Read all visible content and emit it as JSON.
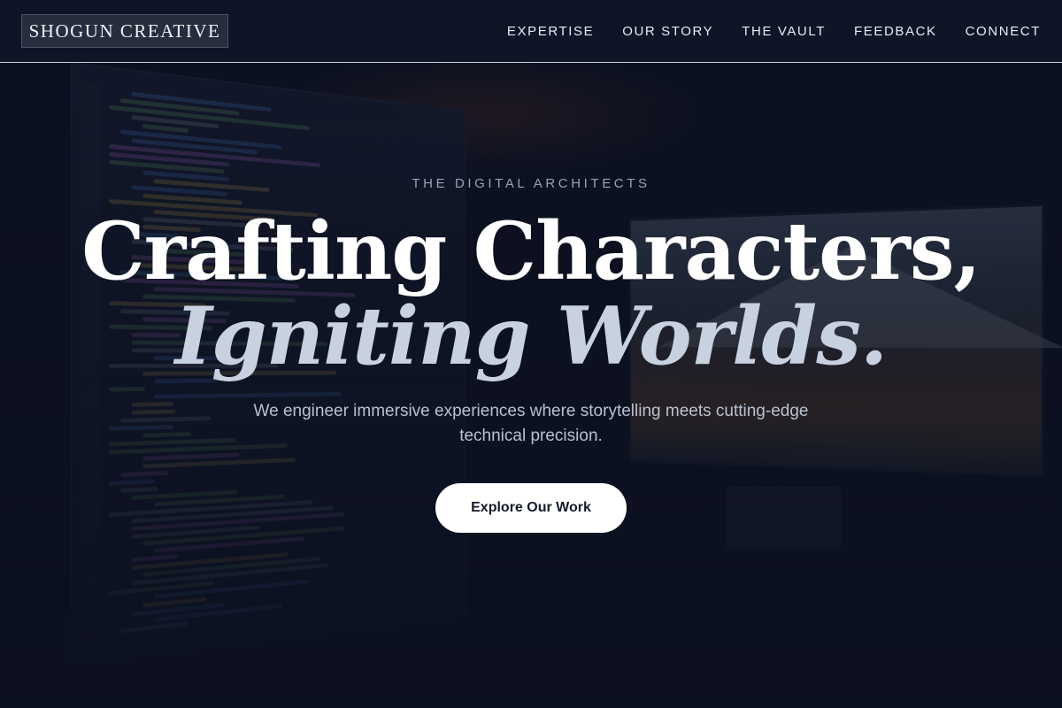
{
  "brand": {
    "name": "SHOGUN CREATIVE"
  },
  "nav": {
    "items": [
      {
        "label": "EXPERTISE"
      },
      {
        "label": "OUR STORY"
      },
      {
        "label": "THE VAULT"
      },
      {
        "label": "FEEDBACK"
      },
      {
        "label": "CONNECT"
      }
    ]
  },
  "hero": {
    "eyebrow": "THE DIGITAL ARCHITECTS",
    "headline_line1": "Crafting Characters,",
    "headline_line2": "Igniting Worlds.",
    "subtitle": "We engineer immersive experiences where storytelling meets cutting-edge technical precision.",
    "cta_label": "Explore Our Work"
  },
  "colors": {
    "background": "#0d1222",
    "header_bg": "#101628",
    "header_rule": "#c9cfda",
    "headline": "#ffffff",
    "headline_accent": "#c8d1e0",
    "eyebrow": "#9aa3b4",
    "cta_bg": "#ffffff",
    "cta_text": "#141a2a"
  }
}
